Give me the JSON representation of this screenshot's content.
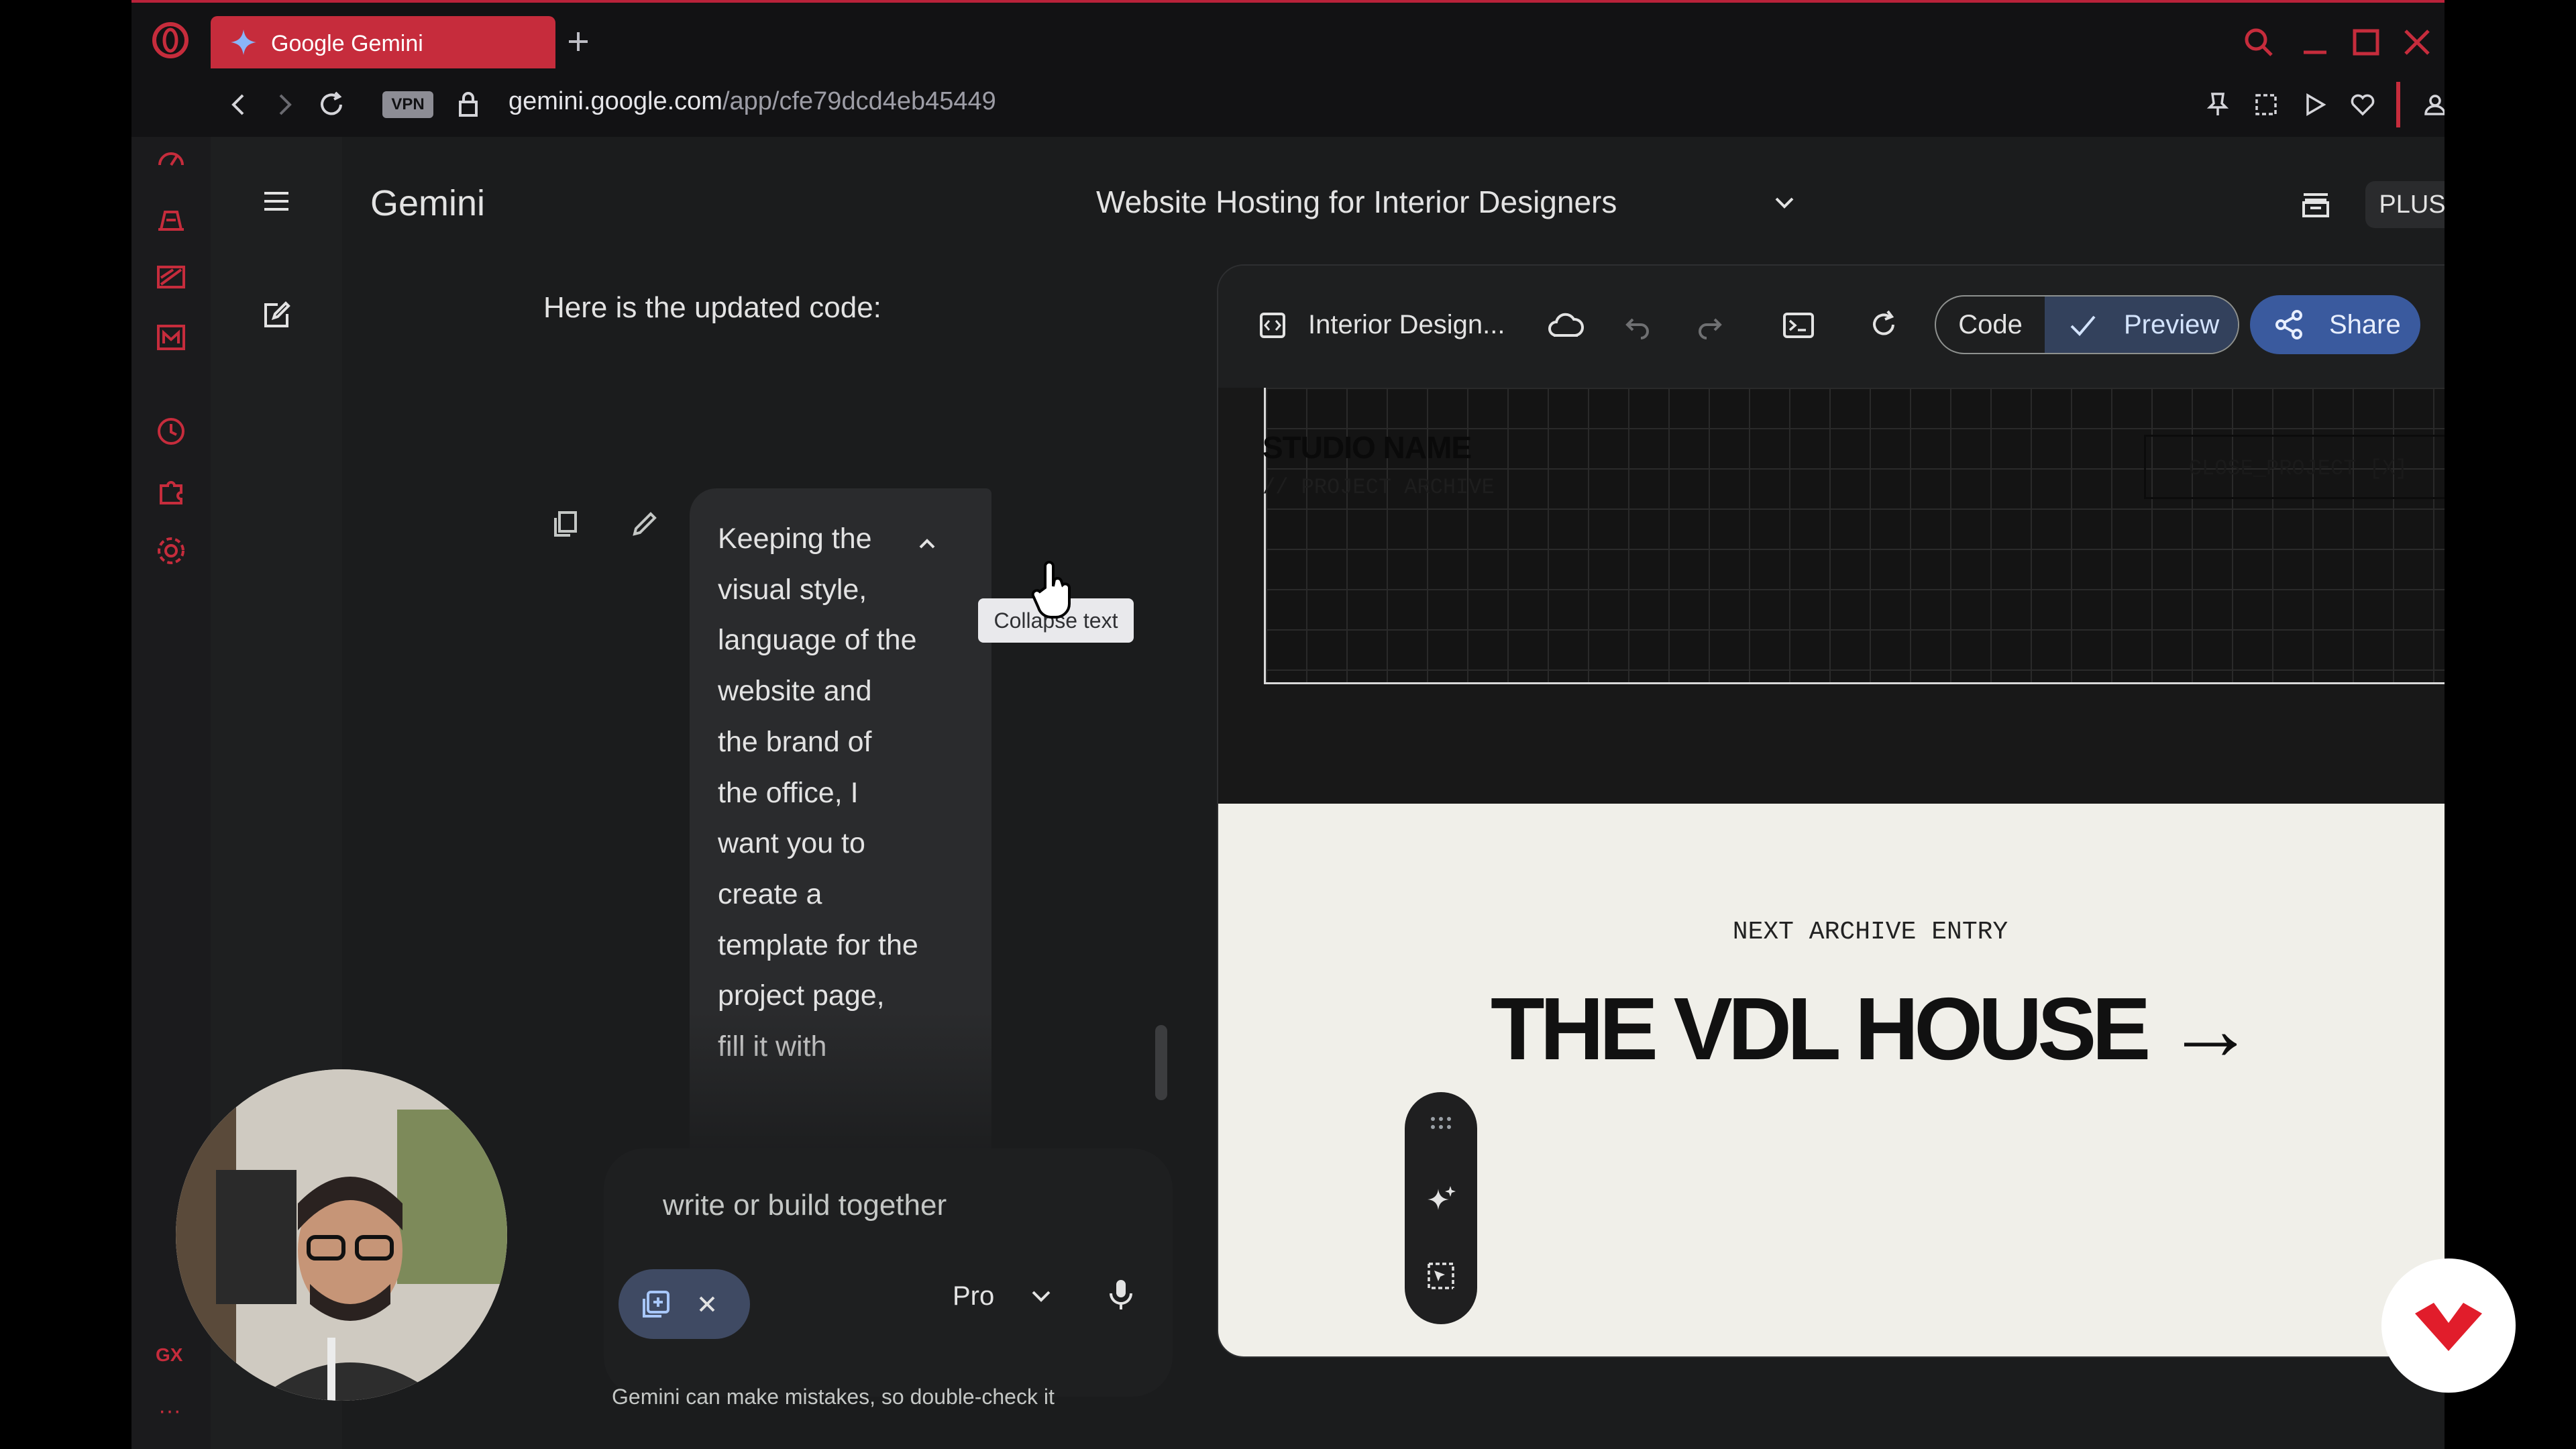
{
  "browser": {
    "tab_title": "Google Gemini",
    "vpn_label": "VPN",
    "url_host": "gemini.google.com",
    "url_path": "/app/cfe79dcd4eb45449",
    "gx_label": "GX",
    "more_label": "···"
  },
  "app": {
    "brand": "Gemini",
    "conversation_title": "Website Hosting for Interior Designers",
    "plan_badge": "PLUS"
  },
  "chat": {
    "response_text": "Here is the updated code:",
    "user_message": "Keeping the visual style, language of the website and the brand of the office, I want you to create a template for the project page, fill it with",
    "tooltip": "Collapse text",
    "input_placeholder": "write or build together",
    "model_label": "Pro",
    "disclaimer": "Gemini can make mistakes, so double-check it"
  },
  "canvas": {
    "document_name": "Interior Design...",
    "code_label": "Code",
    "preview_label": "Preview",
    "share_label": "Share",
    "preview": {
      "studio_name": "STUDIO NAME",
      "archive_label": "// PROJECT ARCHIVE",
      "close_button": "CLOSE_PROJECT [X]",
      "next_label": "NEXT ARCHIVE ENTRY",
      "next_title": "THE VDL HOUSE →"
    }
  },
  "colors": {
    "accent_red": "#c62c3c",
    "share_blue": "#3a5a9e",
    "preview_selected": "#33415c",
    "preview_bg": "#f0efe9"
  }
}
